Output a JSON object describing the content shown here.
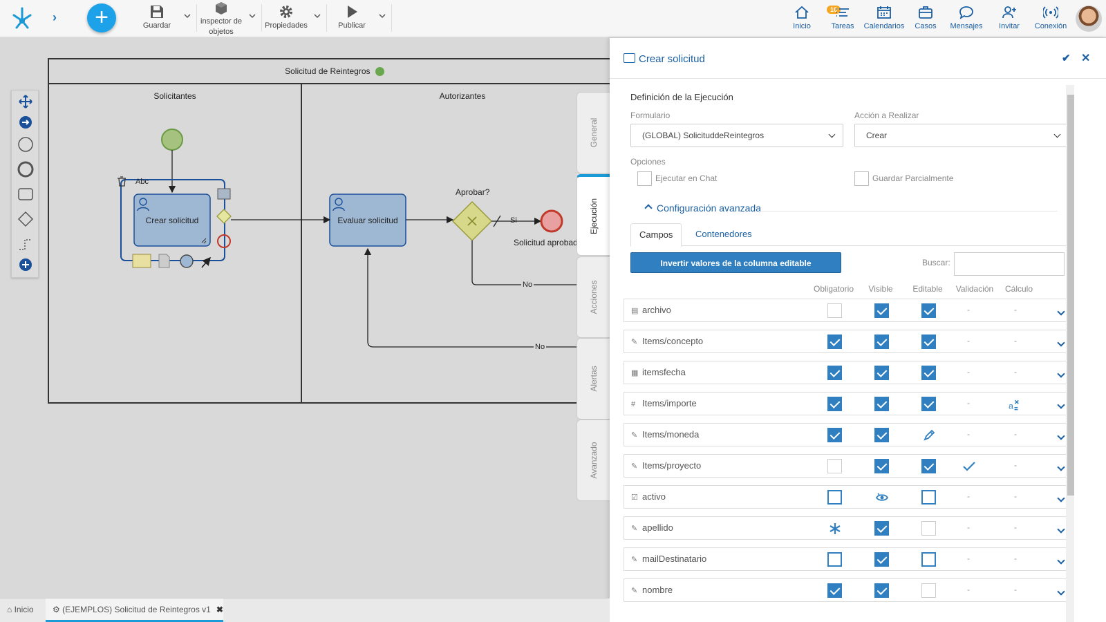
{
  "toolbar": {
    "save_label": "Guardar",
    "inspector_label_1": "inspector de",
    "inspector_label_2": "objetos",
    "properties_label": "Propiedades",
    "publish_label": "Publicar"
  },
  "nav": {
    "home": "Inicio",
    "tasks": "Tareas",
    "tasks_badge": "10",
    "calendars": "Calendarios",
    "cases": "Casos",
    "messages": "Mensajes",
    "invite": "Invitar",
    "connection": "Conexión"
  },
  "diagram": {
    "pool_title": "Solicitud de Reintegros",
    "lane1": "Solicitantes",
    "lane2": "Autorizantes",
    "task1": "Crear solicitud",
    "task2": "Evaluar solicitud",
    "gateway": "Aprobar?",
    "yes": "Si",
    "no1": "No",
    "no2": "No",
    "end": "Solicitud aprobada",
    "annot": "Abc"
  },
  "vtabs": [
    "General",
    "Ejecución",
    "Acciones",
    "Alertas",
    "Avanzado"
  ],
  "panel": {
    "title": "Crear solicitud",
    "section": "Definición de la Ejecución",
    "form_label": "Formulario",
    "form_value": "(GLOBAL) SolicituddeReintegros",
    "action_label": "Acción a Realizar",
    "action_value": "Crear",
    "options_label": "Opciones",
    "opt_chat": "Ejecutar en Chat",
    "opt_partial": "Guardar Parcialmente",
    "advanced": "Configuración avanzada",
    "tab_fields": "Campos",
    "tab_containers": "Contenedores",
    "invert_button": "Invertir valores de la columna editable",
    "search_label": "Buscar:",
    "cols": [
      "Obligatorio",
      "Visible",
      "Editable",
      "Validación",
      "Cálculo"
    ]
  },
  "rows": [
    {
      "name": "archivo",
      "icon": "file-icon",
      "ob": "empty",
      "vi": "chk",
      "ed": "chk",
      "val": "-",
      "calc": "-"
    },
    {
      "name": "Items/concepto",
      "icon": "edit-icon",
      "ob": "chk",
      "vi": "chk",
      "ed": "chk",
      "val": "-",
      "calc": "-"
    },
    {
      "name": "itemsfecha",
      "icon": "calendar-icon",
      "ob": "chk",
      "vi": "chk",
      "ed": "chk",
      "val": "-",
      "calc": "-"
    },
    {
      "name": "Items/importe",
      "icon": "hash-icon",
      "ob": "chk",
      "vi": "chk",
      "ed": "chk",
      "val": "-",
      "calc": "formula-icon"
    },
    {
      "name": "Items/moneda",
      "icon": "edit-icon",
      "ob": "chk",
      "vi": "chk",
      "ed": "pencil-icon",
      "val": "-",
      "calc": "-"
    },
    {
      "name": "Items/proyecto",
      "icon": "edit-icon",
      "ob": "empty",
      "vi": "chk",
      "ed": "chk",
      "val": "checkmark-icon",
      "calc": "-"
    },
    {
      "name": "activo",
      "icon": "checkbox-icon",
      "ob": "emptyb",
      "vi": "eye-icon",
      "ed": "emptyb",
      "val": "-",
      "calc": "-"
    },
    {
      "name": "apellido",
      "icon": "edit-icon",
      "ob": "asterisk-icon",
      "vi": "chk",
      "ed": "empty",
      "val": "-",
      "calc": "-"
    },
    {
      "name": "mailDestinatario",
      "icon": "edit-icon",
      "ob": "emptyb",
      "vi": "chk",
      "ed": "emptyb",
      "val": "-",
      "calc": "-"
    },
    {
      "name": "nombre",
      "icon": "edit-icon",
      "ob": "chk",
      "vi": "chk",
      "ed": "empty",
      "val": "-",
      "calc": "-"
    }
  ],
  "bottom": {
    "home": "Inicio",
    "tab": "(EJEMPLOS) Solicitud de Reintegros v1"
  },
  "colors": {
    "accent": "#2f7fc1",
    "link": "#1a5fa3",
    "tab_indicator": "#1a9ad6"
  }
}
